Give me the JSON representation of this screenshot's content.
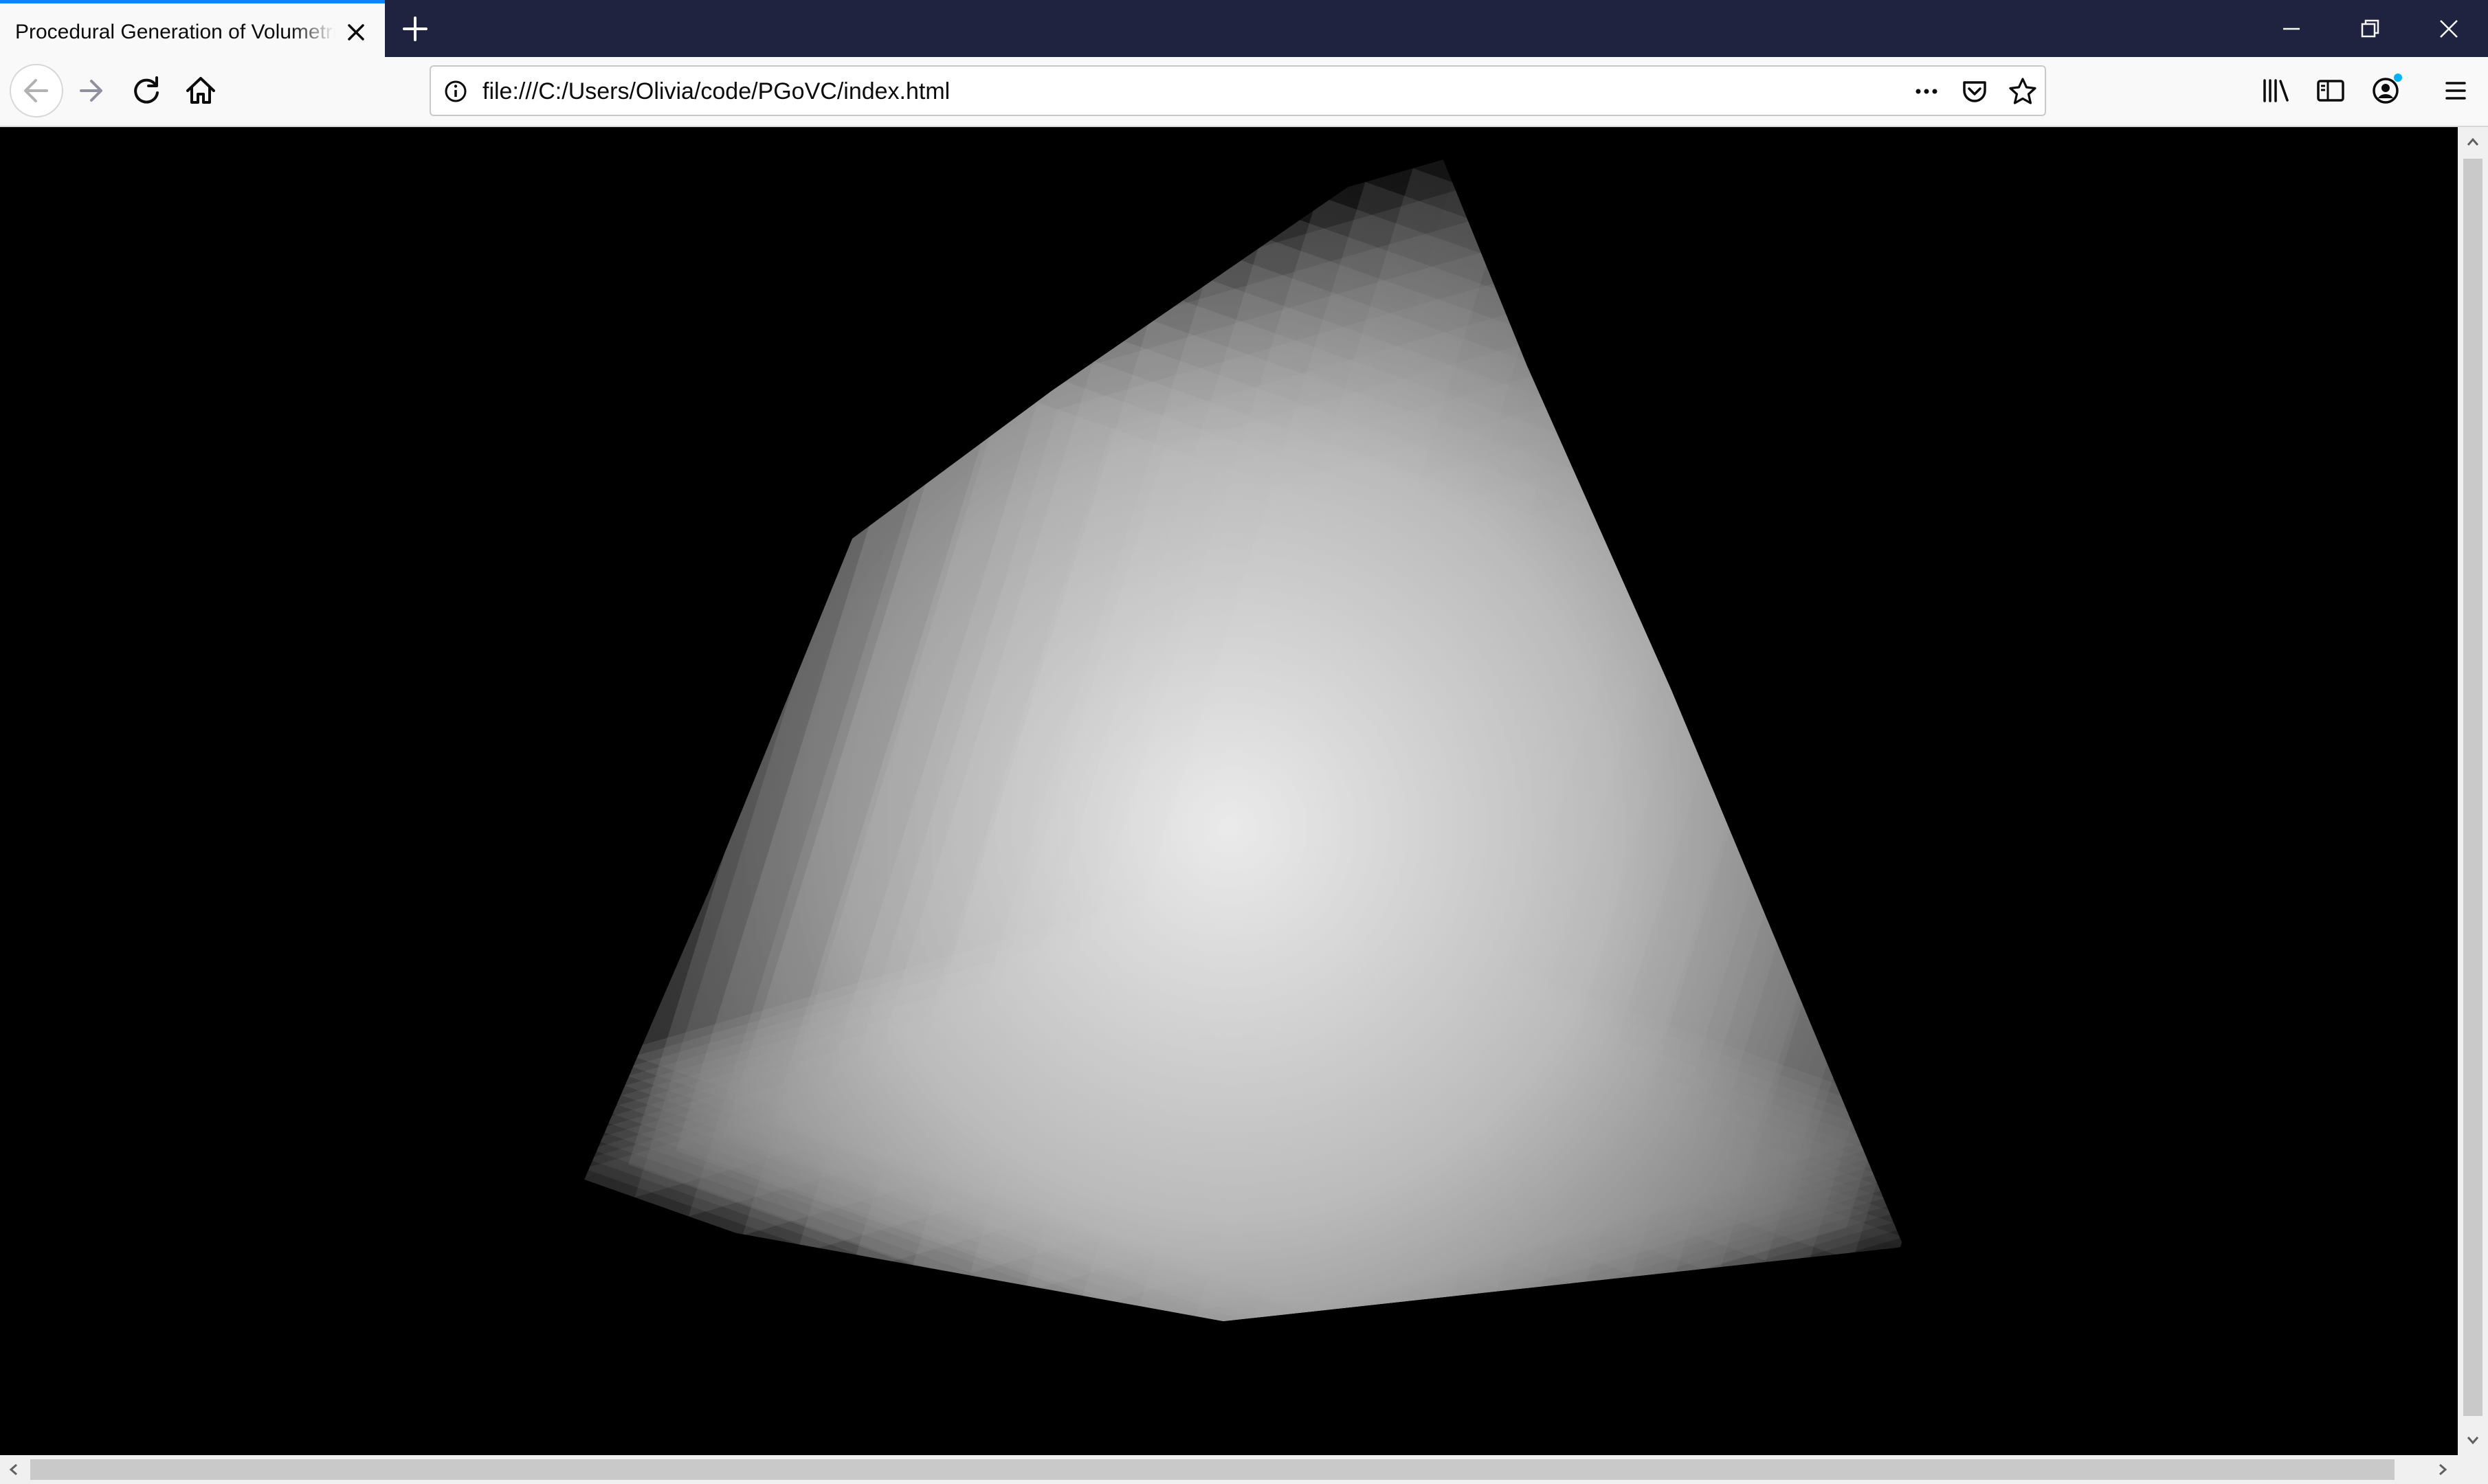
{
  "browser": {
    "tab": {
      "title": "Procedural Generation of Volumetric Clouds",
      "close_icon": "close-icon"
    },
    "new_tab_icon": "plus-icon",
    "window_controls": [
      "minimize-icon",
      "restore-icon",
      "close-icon"
    ],
    "toolbar": {
      "back_icon": "back-arrow-icon",
      "forward_icon": "forward-arrow-icon",
      "reload_icon": "reload-icon",
      "home_icon": "home-icon",
      "url": "file:///C:/Users/Olivia/code/PGoVC/index.html",
      "url_icons": [
        "info-icon",
        "more-icon",
        "pocket-icon",
        "star-icon"
      ],
      "right_icons": [
        "library-icon",
        "sidebar-icon",
        "account-icon",
        "menu-icon"
      ]
    }
  },
  "colors": {
    "tabbar": "#202340",
    "tab_accent": "#0a84ff",
    "toolbar": "#f9f9fa",
    "content_background": "#000000",
    "account_badge": "#00b3f4"
  }
}
